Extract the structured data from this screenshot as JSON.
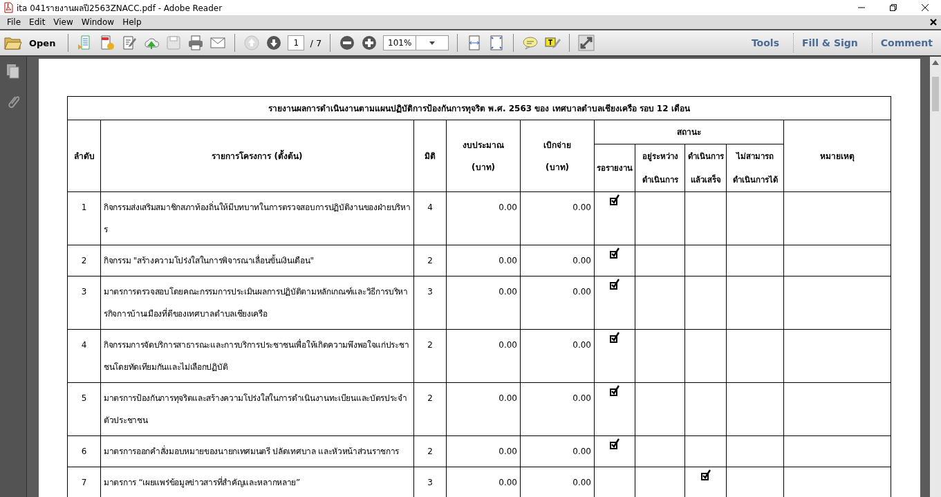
{
  "window": {
    "title": "ita 041รายงานผลปี2563ZNACC.pdf - Adobe Reader"
  },
  "menu": [
    "File",
    "Edit",
    "View",
    "Window",
    "Help"
  ],
  "toolbar": {
    "open_label": "Open",
    "page": "1",
    "page_total": "/ 7",
    "zoom": "101%",
    "panels": [
      "Tools",
      "Fill & Sign",
      "Comment"
    ]
  },
  "table": {
    "title": "รายงานผลการดำเนินงานตามแผนปฏิบัติการป้องกันการทุจริต พ.ศ. 2563 ของ เทศบาลตำบลเชียงเครือ รอบ 12 เดือน",
    "columns": [
      "ลำดับ",
      "รายการโครงการ (ตั้งต้น)",
      "มิติ",
      "งบประมาณ\n(บาท)",
      "เบิกจ่าย\n(บาท)",
      "สถานะ",
      "หมายเหตุ"
    ],
    "status_columns": [
      "รอรายงาน",
      "อยู่ระหว่าง\nดำเนินการ",
      "ดำเนินการ\nแล้วเสร็จ",
      "ไม่สามารถ\nดำเนินการได้"
    ],
    "rows": [
      {
        "no": "1",
        "name": "กิจกรรมส่งเสริมสมาชิกสภาท้องถิ่นให้มีบทบาทในการตรวจสอบการปฏิบัติงานของฝ่ายบริหาร",
        "dimension": "4",
        "budget": "0.00",
        "spent": "0.00",
        "checked": [
          true,
          false,
          false,
          false
        ]
      },
      {
        "no": "2",
        "name": "กิจกรรม \"สร้างความโปร่งใสในการพิจารณาเลื่อนขั้นเงินเดือน\"",
        "dimension": "2",
        "budget": "0.00",
        "spent": "0.00",
        "checked": [
          true,
          false,
          false,
          false
        ]
      },
      {
        "no": "3",
        "name": "มาตรการตรวจสอบโดยคณะกรรมการประเมินผลการปฏิบัติตามหลักเกณฑ์และวิธีการบริหารกิจการบ้านเมืองที่ดีของเทศบาลตำบลเชียงเครือ",
        "dimension": "3",
        "budget": "0.00",
        "spent": "0.00",
        "checked": [
          true,
          false,
          false,
          false
        ]
      },
      {
        "no": "4",
        "name": "กิจกรรมการจัดบริการสาธารณะและการบริการประชาชนเพื่อให้เกิดความพึงพอใจแก่ประชาชนโดยทัดเทียมกันและไม่เลือกปฏิบัติ",
        "dimension": "2",
        "budget": "0.00",
        "spent": "0.00",
        "checked": [
          true,
          false,
          false,
          false
        ]
      },
      {
        "no": "5",
        "name": "มาตรการป้องกันการทุจริตและสร้างความโปร่งใสในการดำเนินงานทะเบียนและบัตรประจำตัวประชาชน",
        "dimension": "2",
        "budget": "0.00",
        "spent": "0.00",
        "checked": [
          true,
          false,
          false,
          false
        ]
      },
      {
        "no": "6",
        "name": "มาตรการออกคำสั่งมอบหมายของนายกเทศมนตรี ปลัดเทศบาล และหัวหน้าส่วนราชการ",
        "dimension": "2",
        "budget": "0.00",
        "spent": "0.00",
        "checked": [
          true,
          false,
          false,
          false
        ]
      },
      {
        "no": "7",
        "name": "มาตรการ “เผยแพร่ข้อมูลข่าวสารที่สำคัญและหลากหลาย”",
        "dimension": "3",
        "budget": "0.00",
        "spent": "0.00",
        "checked": [
          false,
          false,
          true,
          false
        ]
      }
    ]
  }
}
